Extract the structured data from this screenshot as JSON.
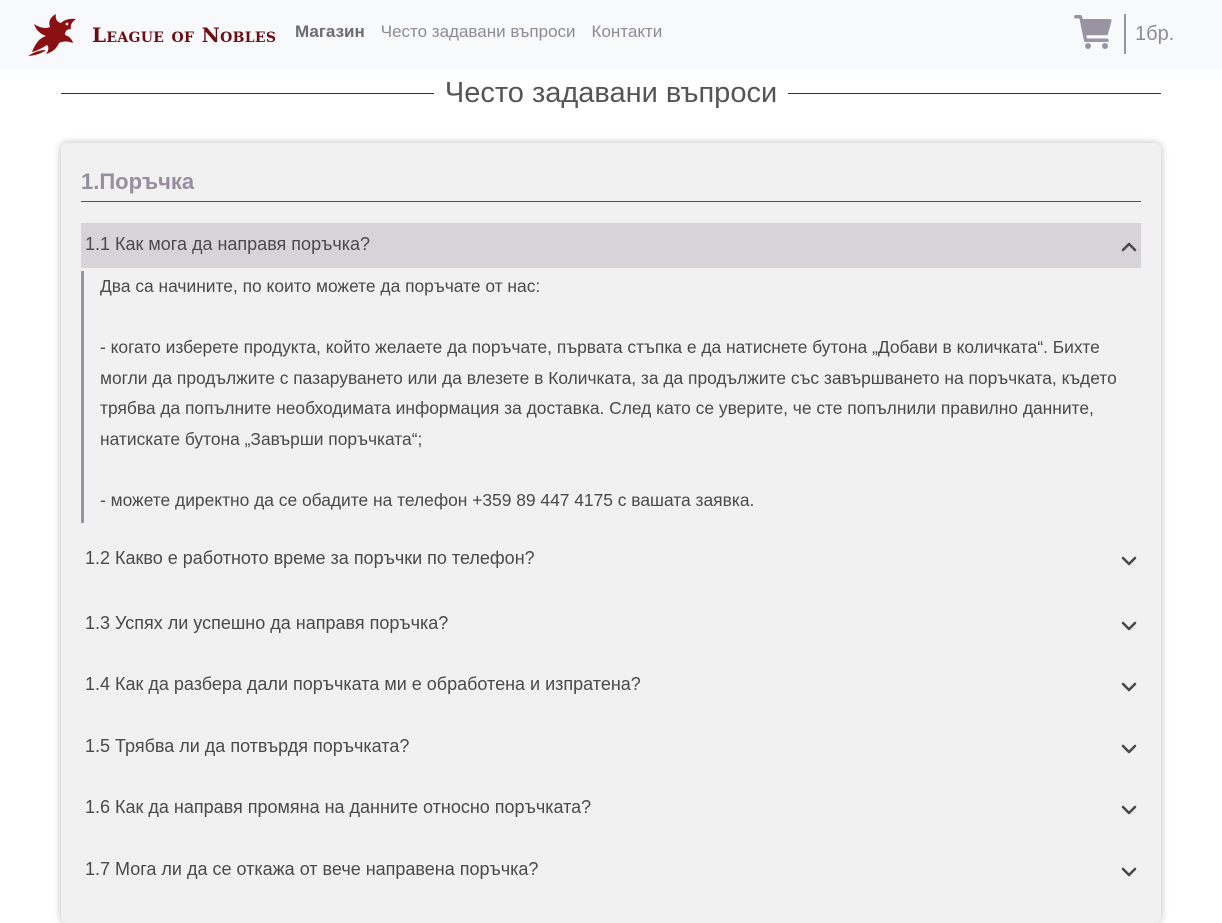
{
  "brand": {
    "name": "League of Nobles",
    "logo_icon": "dragon-logo-icon",
    "color": "#8b1014"
  },
  "nav": {
    "items": [
      {
        "label": "Магазин",
        "active": true
      },
      {
        "label": "Често задавани въпроси",
        "active": false
      },
      {
        "label": "Контакти",
        "active": false
      }
    ]
  },
  "cart": {
    "icon": "cart-icon",
    "count": "1бр.",
    "icon_color": "#9a93a4"
  },
  "page": {
    "title": "Често задавани въпроси"
  },
  "faq": {
    "section_title": "1.Поръчка",
    "open_item": {
      "question": "1.1 Как мога да направя поръчка?",
      "answer": [
        "Два са начините, по които можете да поръчате от нас:",
        "- когато изберете продукта, който желаете да поръчате, първата стъпка е да натиснете бутона „Добави в количката“. Бихте могли да продължите с пазаруването или да влезете в Количката, за да продължите със завършването на поръчката, където трябва да попълните необходимата информация за доставка. След като се уверите, че сте попълнили правилно данните, натискате бутона „Завърши поръчката“;",
        "- можете директно да се обадите на телефон +359 89 447 4175 с вашата заявка."
      ]
    },
    "items": [
      {
        "question": "1.2 Какво е работното време за поръчки по телефон?"
      },
      {
        "question": "1.3 Успях ли успешно да направя поръчка?"
      },
      {
        "question": "1.4 Как да разбера дали поръчката ми е обработена и изпратена?"
      },
      {
        "question": "1.5 Трябва ли да потвърдя поръчката?"
      },
      {
        "question": "1.6 Как да направя промяна на данните относно поръчката?"
      },
      {
        "question": "1.7 Мога ли да се откажа от вече направена поръчка?"
      }
    ]
  }
}
